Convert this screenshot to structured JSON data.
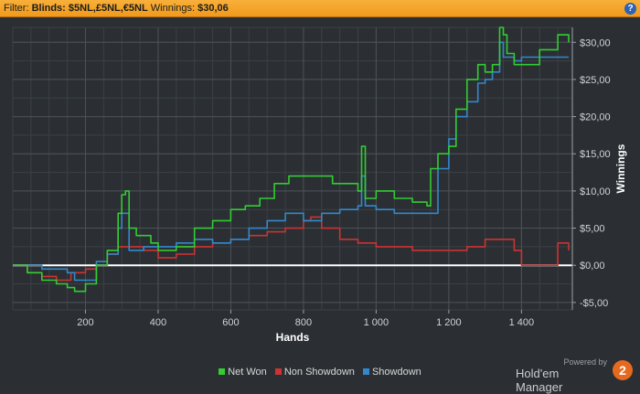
{
  "filter": {
    "label": "Filter:",
    "blinds_label": "Blinds:",
    "blinds_value": "$5NL,£5NL,€5NL",
    "winnings_label": "Winnings:",
    "winnings_value": "$30,06",
    "help_symbol": "?"
  },
  "branding": {
    "powered_by": "Powered by",
    "product": "Hold'em Manager",
    "logo_number": "2"
  },
  "colors": {
    "background": "#2b2f33",
    "grid": "#4a4f55",
    "zero_line": "#ffffff",
    "net_won": "#33cc33",
    "non_showdown": "#cc3333",
    "showdown": "#3388cc"
  },
  "chart_data": {
    "type": "line",
    "xlabel": "Hands",
    "ylabel": "Winnings",
    "xlim": [
      0,
      1540
    ],
    "ylim": [
      -6,
      32
    ],
    "xticks": [
      200,
      400,
      600,
      800,
      1000,
      1200,
      1400
    ],
    "xtick_labels": [
      "200",
      "400",
      "600",
      "800",
      "1 000",
      "1 200",
      "1 400"
    ],
    "yticks": [
      -5,
      0,
      5,
      10,
      15,
      20,
      25,
      30
    ],
    "ytick_labels": [
      "-$5,00",
      "$0,00",
      "$5,00",
      "$10,00",
      "$15,00",
      "$20,00",
      "$25,00",
      "$30,00"
    ],
    "grid": true,
    "legend_position": "bottom",
    "series": [
      {
        "name": "Net Won",
        "color": "#33cc33",
        "x": [
          0,
          40,
          80,
          120,
          150,
          170,
          200,
          230,
          260,
          290,
          300,
          310,
          320,
          340,
          380,
          400,
          450,
          500,
          550,
          600,
          640,
          680,
          720,
          760,
          800,
          840,
          880,
          920,
          950,
          960,
          970,
          1000,
          1050,
          1100,
          1140,
          1150,
          1170,
          1200,
          1220,
          1250,
          1280,
          1300,
          1320,
          1340,
          1350,
          1360,
          1380,
          1400,
          1450,
          1500,
          1530
        ],
        "y": [
          0,
          -1,
          -2,
          -2.5,
          -3,
          -3.5,
          -2.5,
          0,
          2,
          7,
          9.5,
          10,
          5,
          4,
          3,
          2,
          2.5,
          5,
          6,
          7.5,
          8,
          9,
          11,
          12,
          12,
          12,
          11,
          11,
          10,
          16,
          9,
          10,
          9,
          8.5,
          8,
          13,
          15,
          16,
          21,
          25,
          27,
          26,
          27,
          32,
          31,
          28.5,
          27,
          27,
          29,
          31,
          30
        ]
      },
      {
        "name": "Non Showdown",
        "color": "#cc3333",
        "x": [
          0,
          40,
          80,
          120,
          160,
          200,
          230,
          260,
          290,
          320,
          360,
          400,
          450,
          500,
          550,
          600,
          650,
          700,
          750,
          800,
          820,
          850,
          900,
          950,
          1000,
          1050,
          1100,
          1150,
          1200,
          1250,
          1300,
          1350,
          1380,
          1400,
          1450,
          1500,
          1530
        ],
        "y": [
          0,
          -1,
          -1.5,
          -2,
          -1,
          -0.5,
          0,
          1.5,
          2.5,
          2.5,
          2,
          1,
          1.5,
          2.5,
          3,
          3.5,
          4,
          4.5,
          5,
          6,
          6.5,
          5,
          3.5,
          3,
          2.5,
          2.5,
          2,
          2,
          2,
          2.5,
          3.5,
          3.5,
          2,
          0,
          0,
          3,
          2
        ]
      },
      {
        "name": "Showdown",
        "color": "#3388cc",
        "x": [
          0,
          40,
          80,
          120,
          150,
          170,
          200,
          230,
          260,
          290,
          300,
          310,
          320,
          360,
          400,
          450,
          500,
          550,
          600,
          650,
          700,
          750,
          800,
          850,
          900,
          950,
          960,
          970,
          1000,
          1050,
          1100,
          1150,
          1170,
          1200,
          1220,
          1250,
          1280,
          1300,
          1320,
          1340,
          1350,
          1380,
          1400,
          1450,
          1500,
          1530
        ],
        "y": [
          0,
          0,
          -0.5,
          -0.5,
          -1,
          -2,
          -2,
          0.5,
          1.5,
          5,
          7,
          7,
          2,
          2.5,
          2.5,
          3,
          3.5,
          3,
          3.5,
          5,
          6,
          7,
          6,
          7,
          7.5,
          8,
          12,
          8,
          7.5,
          7,
          7,
          7,
          13,
          17,
          20,
          22,
          24.5,
          25,
          26,
          30,
          28,
          27.5,
          28,
          28,
          28,
          28
        ]
      }
    ]
  }
}
